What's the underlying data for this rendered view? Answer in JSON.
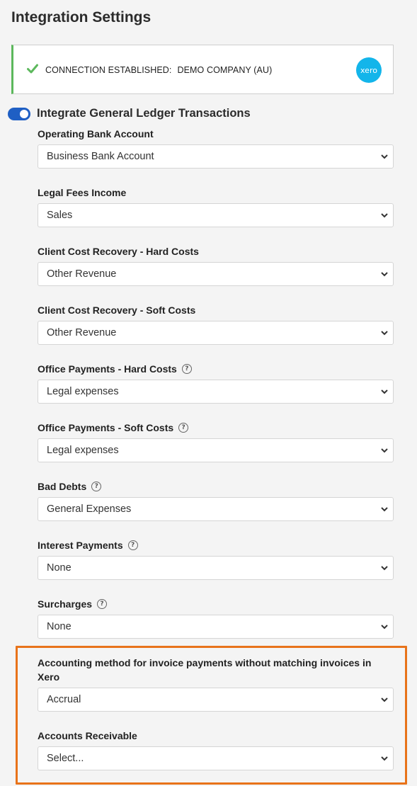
{
  "page": {
    "title": "Integration Settings"
  },
  "connection": {
    "status": "CONNECTION ESTABLISHED:",
    "company": "DEMO COMPANY (AU)",
    "logo_text": "xero",
    "status_color": "#5cb85c",
    "logo_color": "#13b5ea"
  },
  "gl_toggle": {
    "label": "Integrate General Ledger Transactions",
    "enabled": true
  },
  "fields": {
    "operating_bank": {
      "label": "Operating Bank Account",
      "value": "Business Bank Account"
    },
    "legal_fees": {
      "label": "Legal Fees Income",
      "value": "Sales"
    },
    "ccr_hard": {
      "label": "Client Cost Recovery - Hard Costs",
      "value": "Other Revenue"
    },
    "ccr_soft": {
      "label": "Client Cost Recovery - Soft Costs",
      "value": "Other Revenue"
    },
    "op_hard": {
      "label": "Office Payments - Hard Costs",
      "value": "Legal expenses"
    },
    "op_soft": {
      "label": "Office Payments - Soft Costs",
      "value": "Legal expenses"
    },
    "bad_debts": {
      "label": "Bad Debts",
      "value": "General Expenses"
    },
    "interest": {
      "label": "Interest Payments",
      "value": "None"
    },
    "surcharges": {
      "label": "Surcharges",
      "value": "None"
    },
    "accounting_method": {
      "label": "Accounting method for invoice payments without matching invoices in Xero",
      "value": "Accrual"
    },
    "accounts_receivable": {
      "label": "Accounts Receivable",
      "value": "Select..."
    }
  },
  "help_glyph": "?",
  "colors": {
    "toggle": "#1f5fc4",
    "highlight": "#e8731a"
  }
}
